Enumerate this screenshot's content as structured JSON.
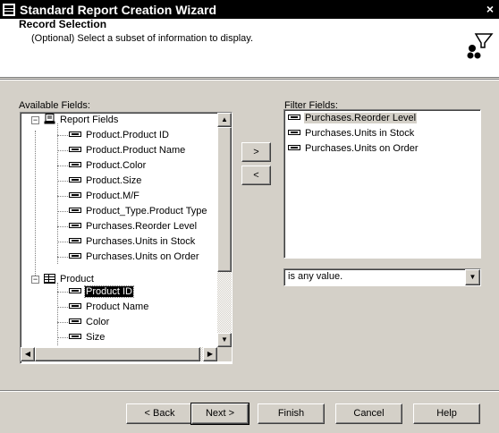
{
  "window": {
    "title": "Standard Report Creation Wizard",
    "close_glyph": "×"
  },
  "header": {
    "title": "Record Selection",
    "subtitle": "(Optional) Select a subset of information to display.",
    "icon": "filter-funnel-icon"
  },
  "available_fields": {
    "label": "Available Fields:",
    "groups": [
      {
        "label": "Report Fields",
        "expander": "−",
        "icon": "report-fields-icon",
        "items": [
          "Product.Product ID",
          "Product.Product Name",
          "Product.Color",
          "Product.Size",
          "Product.M/F",
          "Product_Type.Product Type",
          "Purchases.Reorder Level",
          "Purchases.Units in Stock",
          "Purchases.Units on Order"
        ]
      },
      {
        "label": "Product",
        "expander": "−",
        "icon": "table-icon",
        "items": [
          "Product ID",
          "Product Name",
          "Color",
          "Size"
        ]
      }
    ],
    "selected_item": "Product ID"
  },
  "transfer_buttons": {
    "add": ">",
    "remove": "<"
  },
  "filter_fields": {
    "label": "Filter Fields:",
    "items": [
      "Purchases.Reorder Level",
      "Purchases.Units in Stock",
      "Purchases.Units on Order"
    ],
    "selected_item": "Purchases.Reorder Level"
  },
  "filter_condition": {
    "value": "is any value.",
    "arrow": "▼"
  },
  "footer": {
    "back_label": "< Back",
    "next_label": "Next >",
    "finish_label": "Finish",
    "cancel_label": "Cancel",
    "help_label": "Help"
  }
}
